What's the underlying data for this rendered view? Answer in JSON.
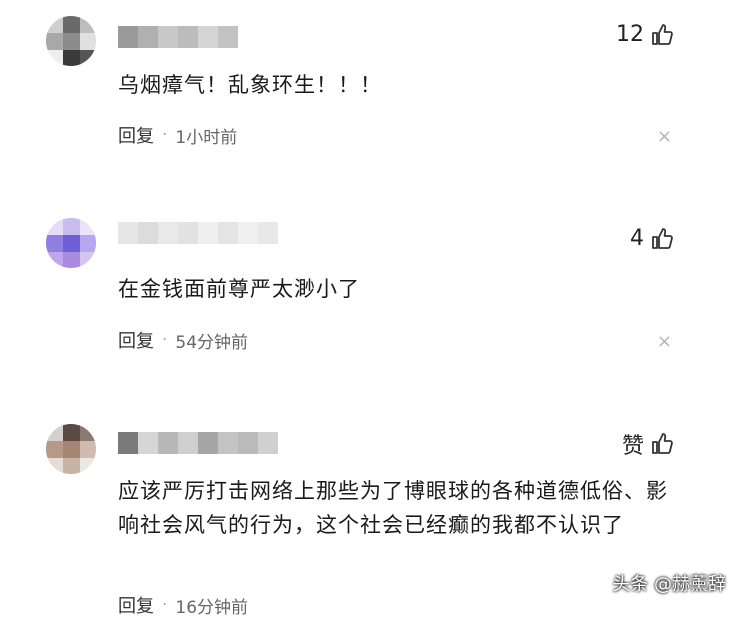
{
  "comments": [
    {
      "likes": "12",
      "text": "乌烟瘴气！乱象环生！！！",
      "reply_label": "回复",
      "time": "1小时前",
      "close": "×"
    },
    {
      "likes": "4",
      "text": "在金钱面前尊严太渺小了",
      "reply_label": "回复",
      "time": "54分钟前",
      "close": "×"
    },
    {
      "likes": "赞",
      "text": "应该严厉打击网络上那些为了博眼球的各种道德低俗、影响社会风气的行为，这个社会已经癫的我都不认识了",
      "reply_label": "回复",
      "time": "16分钟前",
      "close": "×"
    }
  ],
  "separator": "·",
  "watermark": "头条 @赫薰辞",
  "icons": [
    "thumb-up-icon",
    "close-icon"
  ],
  "colors": {
    "text": "#1a1a1a",
    "meta": "#666666",
    "close": "#b5b5b5"
  }
}
